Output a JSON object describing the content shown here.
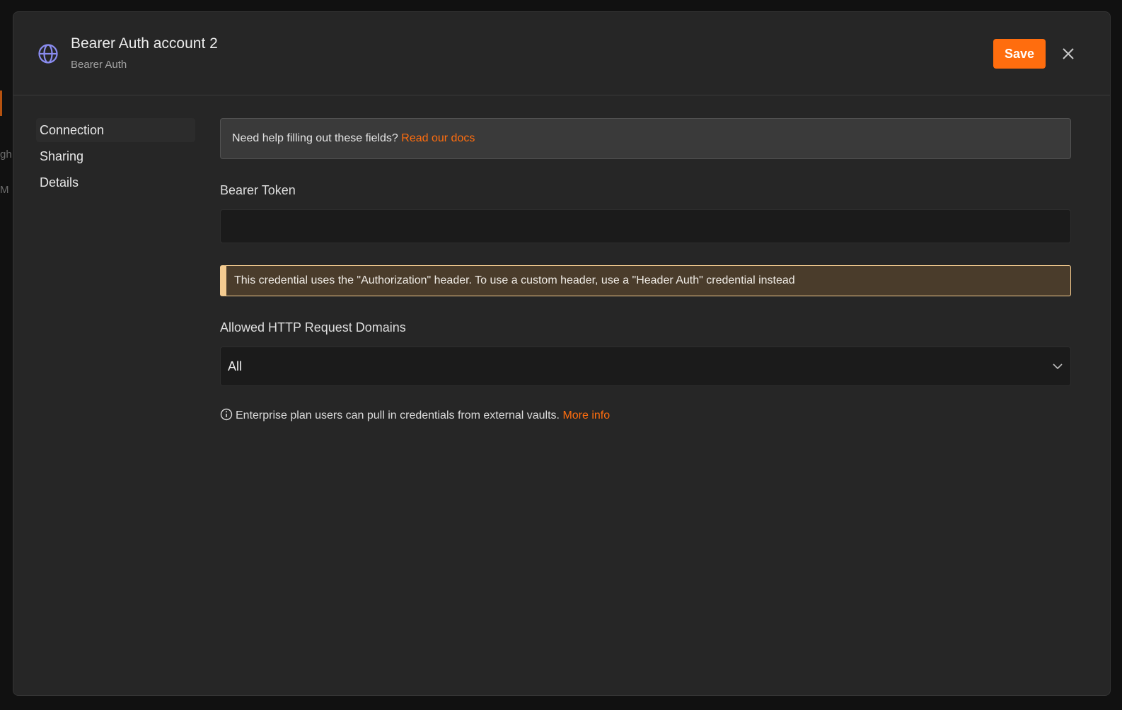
{
  "modal": {
    "title": "Bearer Auth account 2",
    "subtitle": "Bearer Auth",
    "save_label": "Save",
    "header_icon": "globe-icon",
    "close_icon": "close-icon"
  },
  "sidebar": {
    "items": [
      {
        "label": "Connection",
        "active": true
      },
      {
        "label": "Sharing",
        "active": false
      },
      {
        "label": "Details",
        "active": false
      }
    ]
  },
  "help": {
    "text": "Need help filling out these fields?",
    "link": "Read our docs"
  },
  "bearer_token": {
    "label": "Bearer Token",
    "value": "",
    "placeholder": ""
  },
  "warning": {
    "text": "This credential uses the \"Authorization\" header. To use a custom header, use a \"Header Auth\" credential instead"
  },
  "domains": {
    "label": "Allowed HTTP Request Domains",
    "selected": "All",
    "chevron_icon": "chevron-down-icon"
  },
  "info": {
    "text": "Enterprise plan users can pull in credentials from external vaults.",
    "link": "More info",
    "icon": "info-circle-icon"
  },
  "colors": {
    "accent": "#ff6d0e",
    "modal_bg": "#262626",
    "warning_bg": "#4a3c2b",
    "warning_border": "#f4cb90",
    "globe_icon": "#8a8cf0"
  }
}
